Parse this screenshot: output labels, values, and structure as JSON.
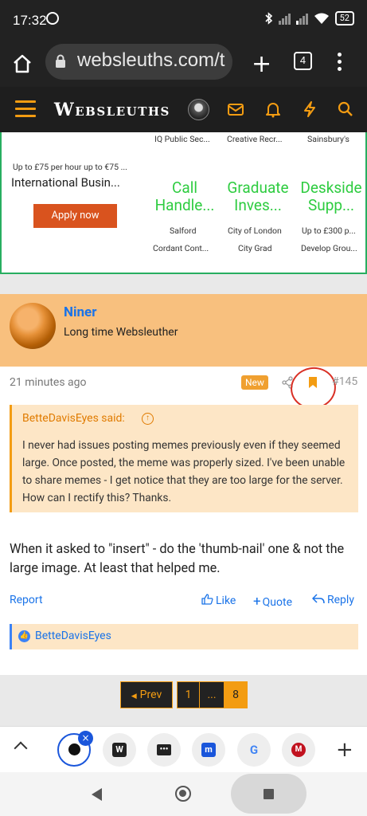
{
  "status_bar": {
    "time": "17:32",
    "battery": "52"
  },
  "browser": {
    "url": "websleuths.com/t",
    "tab_count": "4"
  },
  "site": {
    "logo_prefix": "W",
    "logo_rest": "EBSLEUTHS"
  },
  "ads": {
    "top_cut_left": "IQ Public Sec...",
    "top_cut_mid": "Creative Recr...",
    "top_cut_right": "Sainsbury's",
    "salary": "Up to £75 per hour up to €75 ...",
    "title": "International Busin...",
    "apply": "Apply now",
    "cards": [
      {
        "title": "Call Handle...",
        "location": "Salford",
        "company": "Cordant Cont..."
      },
      {
        "title": "Graduate Inves...",
        "location": "City of London",
        "company": "City Grad"
      },
      {
        "title": "Deskside Supp...",
        "location": "Up to £300 p...",
        "company": "Develop Grou..."
      }
    ]
  },
  "post": {
    "username": "Niner",
    "user_title": "Long time Websleuther",
    "timestamp": "21 minutes ago",
    "badge": "New",
    "post_number": "#145",
    "quote_author": "BetteDavisEyes said:",
    "quote_text": "I never had issues posting memes previously even if they seemed large. Once posted, the meme was properly sized. I've been unable to share memes - I get notice that they are too large for the server. How can I rectify this? Thanks.",
    "message": "When it asked to \"insert\" - do the 'thumb-nail' one & not the large image. At least that helped me.",
    "report": "Report",
    "like": "Like",
    "quote": "Quote",
    "reply": "Reply",
    "reaction_user": "BetteDavisEyes"
  },
  "pagination": {
    "prev": "Prev",
    "pages": [
      "1",
      "...",
      "8"
    ],
    "current": "8"
  },
  "colors": {
    "accent": "#f39c12",
    "link": "#1a73e8",
    "post_header": "#f8c07e",
    "header_bg": "#1e1e1e"
  }
}
